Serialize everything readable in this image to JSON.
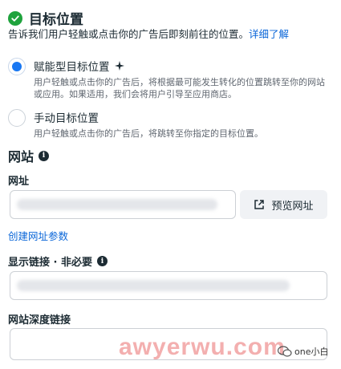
{
  "header": {
    "title": "目标位置"
  },
  "description": {
    "text": "告诉我们用户轻触或点击你的广告后即刻前往的位置。",
    "link": "详细了解"
  },
  "options": [
    {
      "title": "赋能型目标位置",
      "desc": "用户轻触或点击你的广告后，将根据最可能发生转化的位置跳转至你的网站或应用。如果适用，我们会将用户引导至应用商店。",
      "selected": true
    },
    {
      "title": "手动目标位置",
      "desc": "用户轻触或点击你的广告后，将跳转至你指定的目标位置。",
      "selected": false
    }
  ],
  "website": {
    "section_title": "网站",
    "url_label": "网址",
    "preview_button": "预览网址",
    "create_params_link": "创建网址参数",
    "display_link_label": "显示链接 · 非必要",
    "deep_link_label": "网站深度链接"
  },
  "watermark": {
    "text": "awyerwu.com",
    "brand": "one小白"
  },
  "colors": {
    "accent": "#1877f2",
    "link": "#0a66d8",
    "success": "#1fa33d"
  }
}
